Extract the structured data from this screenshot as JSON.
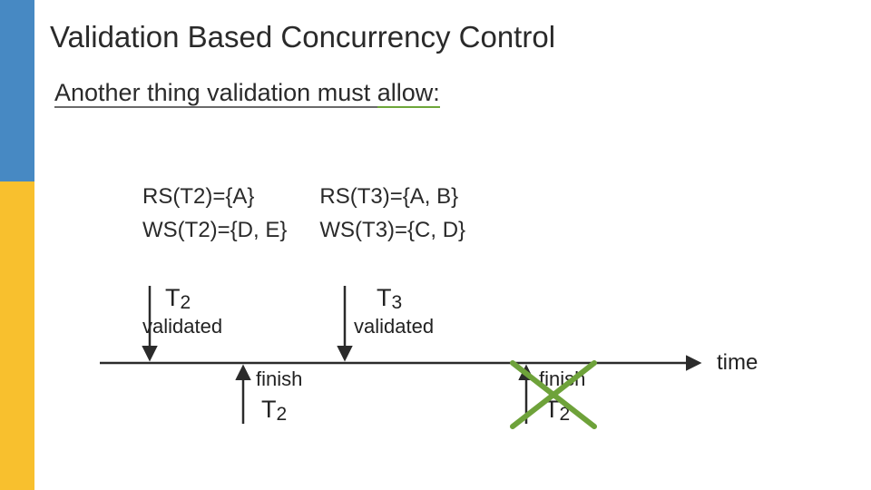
{
  "title": "Validation Based Concurrency Control",
  "subtitle_prefix": "Another thing validation must ",
  "subtitle_allow": "allow:",
  "sets": {
    "rs_t2": "RS(T2)={A}",
    "ws_t2": "WS(T2)={D, E}",
    "rs_t3": "RS(T3)={A, B}",
    "ws_t3": "WS(T3)={C, D}"
  },
  "timeline": {
    "t2_label": "T2",
    "t3_label": "T3",
    "validated": "validated",
    "finish": "finish",
    "finish_t2_a": "T2",
    "finish_t2_b": "T2",
    "time_label": "time"
  },
  "colors": {
    "green": "#6ea23a",
    "arrow": "#2b2b2b",
    "axis": "#2b2b2b"
  }
}
